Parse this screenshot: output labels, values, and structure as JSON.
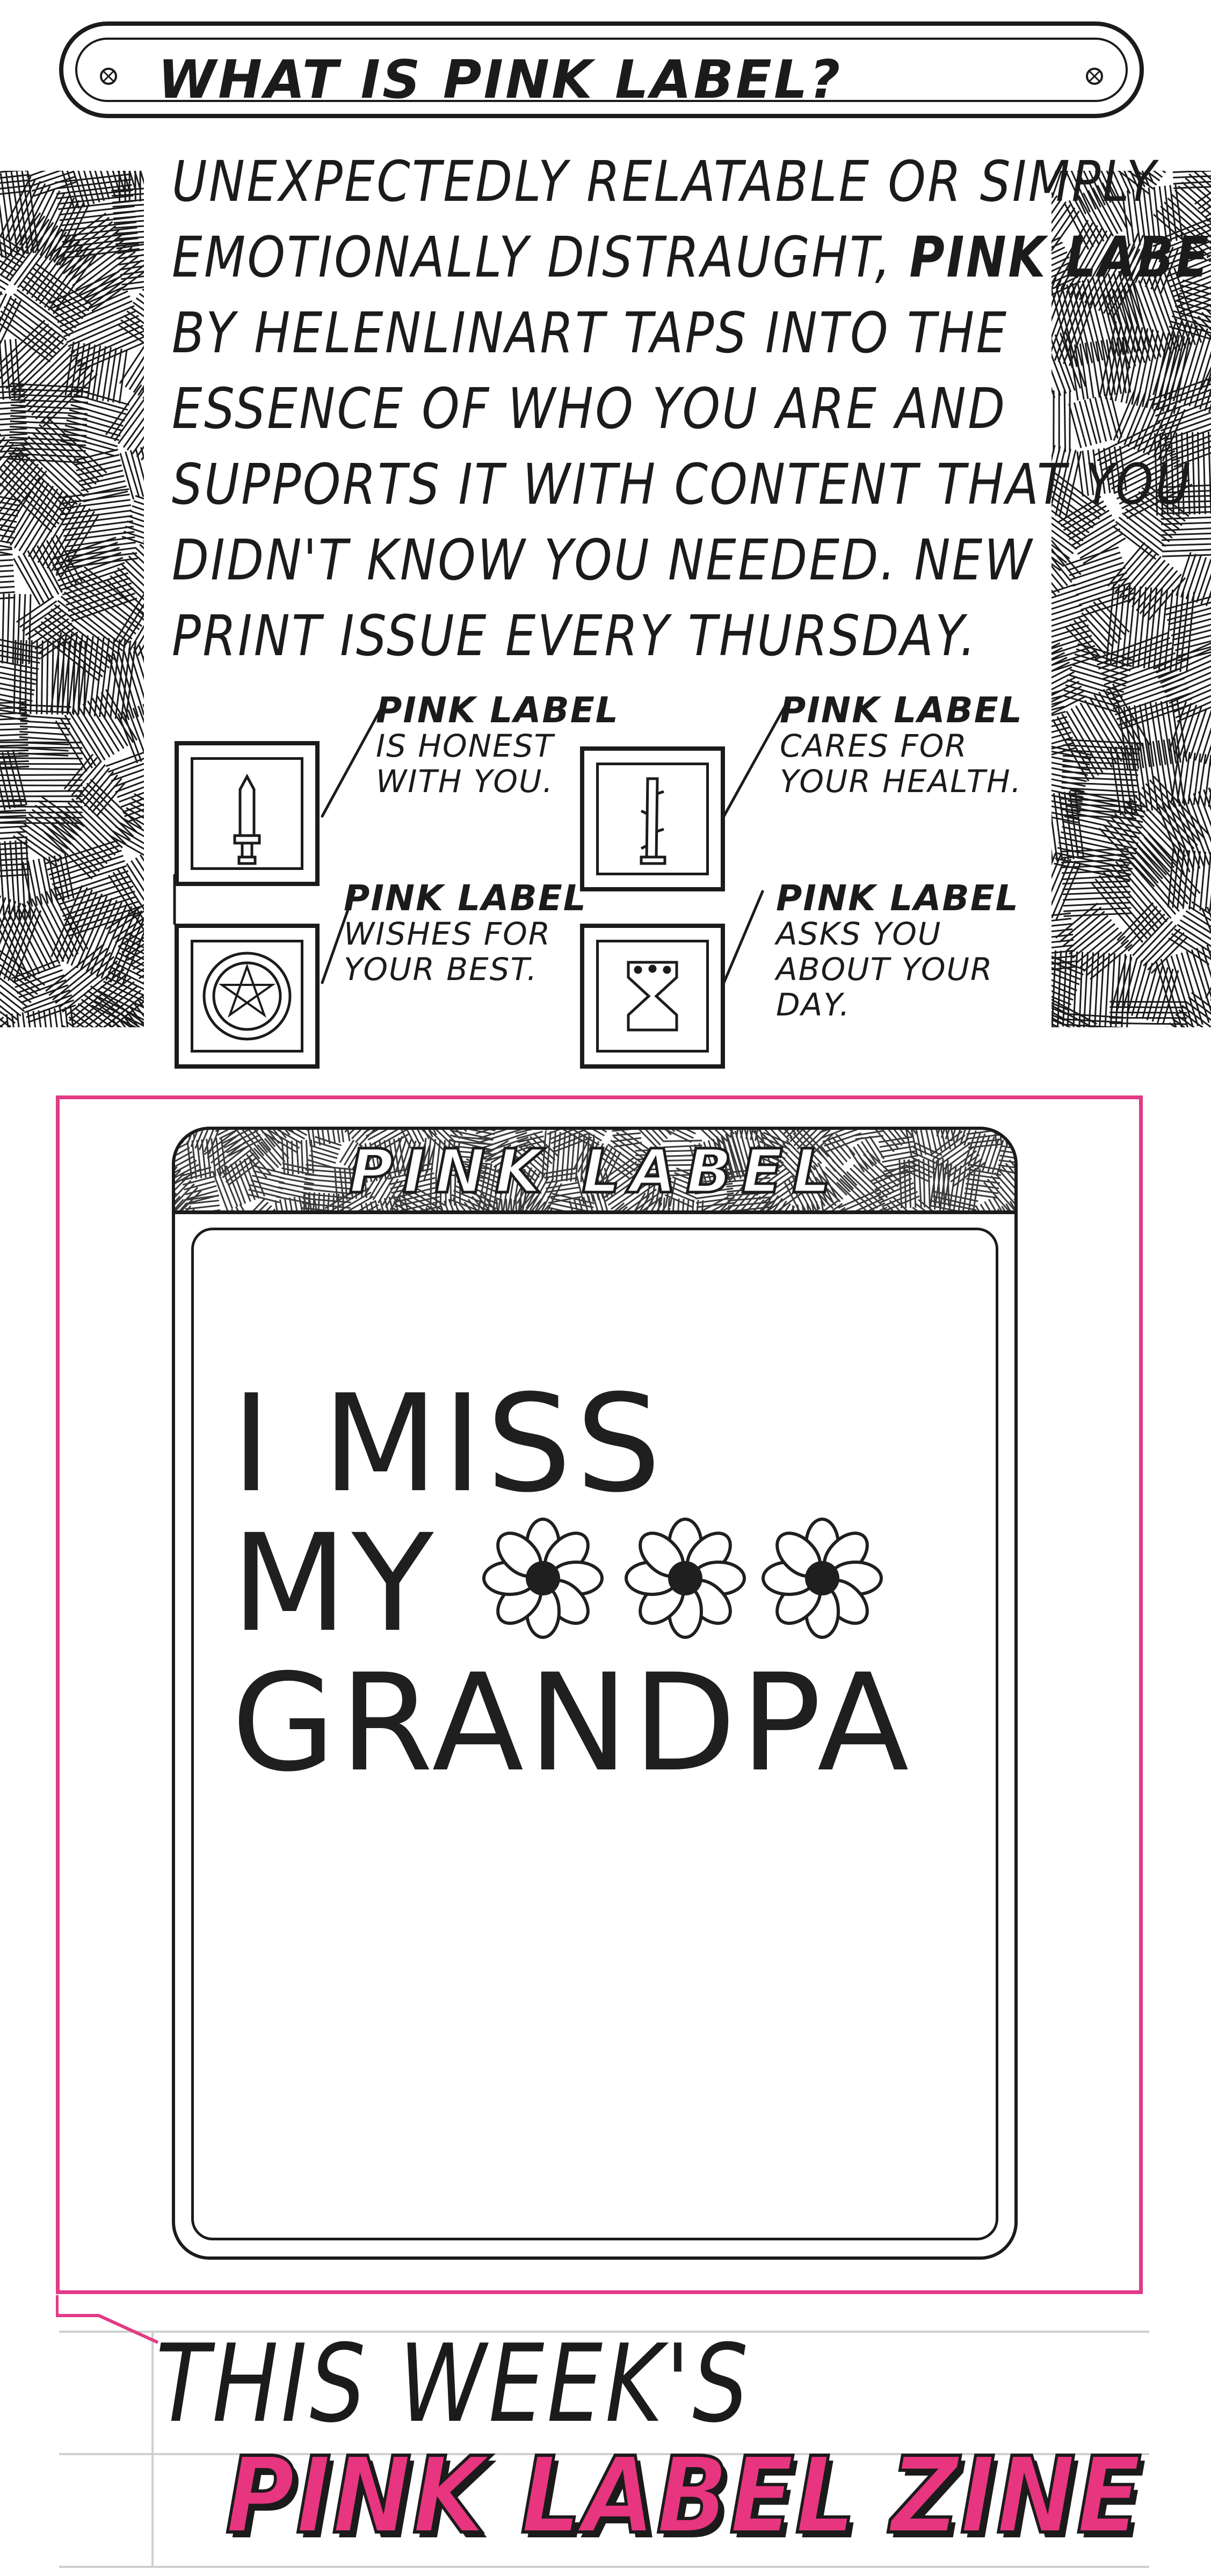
{
  "header": {
    "title": "WHAT IS PINK LABEL?"
  },
  "intro": {
    "line1": "UNEXPECTEDLY RELATABLE OR SIMPLY",
    "line2_pre": "EMOTIONALLY DISTRAUGHT,",
    "line2_brand": "PINK LABEL",
    "line3": "BY HELENLINART TAPS INTO THE",
    "line4": "ESSENCE OF WHO YOU ARE AND",
    "line5": "SUPPORTS IT WITH CONTENT THAT YOU",
    "line6": "DIDN'T KNOW YOU NEEDED. NEW",
    "line7": "PRINT ISSUE EVERY THURSDAY."
  },
  "traits": [
    {
      "brand": "PINK LABEL",
      "lines": [
        "IS HONEST",
        "WITH YOU."
      ],
      "icon": "sword-icon"
    },
    {
      "brand": "PINK LABEL",
      "lines": [
        "CARES FOR",
        "YOUR HEALTH."
      ],
      "icon": "wand-icon"
    },
    {
      "brand": "PINK LABEL",
      "lines": [
        "WISHES FOR",
        "YOUR BEST."
      ],
      "icon": "pentacle-icon"
    },
    {
      "brand": "PINK LABEL",
      "lines": [
        "ASKS YOU",
        "ABOUT YOUR",
        "DAY."
      ],
      "icon": "cup-icon"
    }
  ],
  "card": {
    "title": "PINK LABEL",
    "line1": "I MISS",
    "line2": "MY",
    "line3": "GRANDPA"
  },
  "banner": {
    "kicker": "THIS WEEK'S",
    "title": "PINK LABEL ZINE"
  },
  "colors": {
    "ink": "#1b1b1b",
    "pink": "#e8357f",
    "frame_pink": "#e23a86",
    "paper": "#ffffff"
  }
}
